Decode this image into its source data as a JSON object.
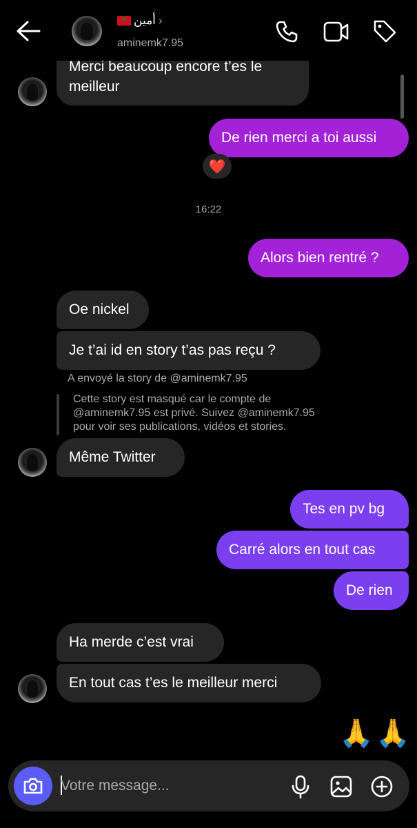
{
  "header": {
    "contact_name": "أمين",
    "handle": "aminemk7.95",
    "chevron": "›",
    "icons": [
      "back-arrow-icon",
      "phone-icon",
      "video-call-icon",
      "tag-icon"
    ]
  },
  "messages": {
    "m1": "Merci beaucoup encore t’es le",
    "m1b": "meilleur",
    "m2": "De rien merci a toi aussi",
    "reaction": "❤️",
    "timestamp": "16:22",
    "m3": "Alors bien rentré ?",
    "m4": "Oe nickel",
    "m5": "Je t’ai id en story t’as pas reçu ?",
    "story_label": "A envoyé la story de @aminemk7.95",
    "story_line1": "Cette story est masqué car le compte de",
    "story_line2": "@aminemk7.95 est privé. Suivez @aminemk7.95",
    "story_line3": "pour voir ses publications, vidéos et stories.",
    "m6": "Même Twitter",
    "m7": "Tes en pv bg",
    "m8": "Carré alors en tout cas",
    "m9": "De rien",
    "m10": "Ha merde c’est vrai",
    "m11": "En tout cas t’es le meilleur merci",
    "emoji1": "🙏",
    "emoji2": "🙏"
  },
  "composer": {
    "placeholder": "Votre message...",
    "icons": [
      "camera-icon",
      "microphone-icon",
      "gallery-icon",
      "plus-icon"
    ]
  },
  "colors": {
    "background": "#000000",
    "incoming": "#262626",
    "outgoing_pink": "#a322d8",
    "outgoing_purple": "#7b3ff0",
    "camera_button": "#5b5cf6"
  }
}
